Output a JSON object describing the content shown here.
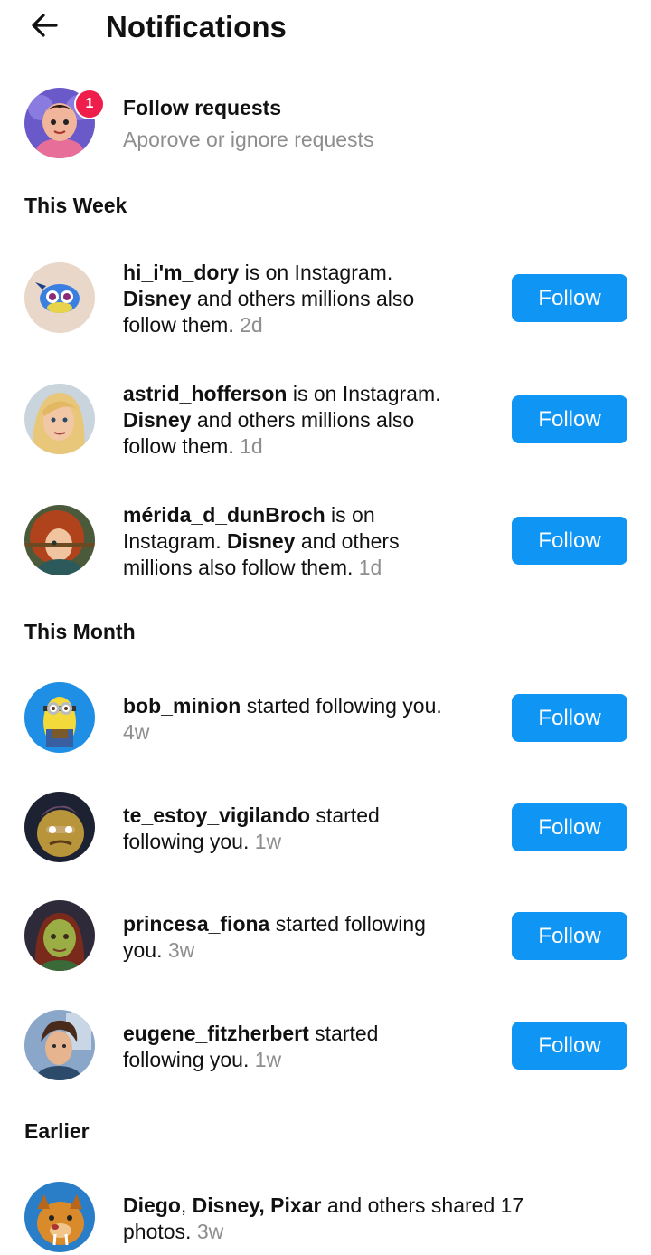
{
  "header": {
    "title": "Notifications",
    "back_icon": "arrow-left-icon"
  },
  "follow_requests": {
    "title": "Follow requests",
    "subtitle": "Aporove or ignore requests",
    "badge_count": "1"
  },
  "sections": {
    "this_week": "This Week",
    "this_month": "This Month",
    "earlier": "Earlier"
  },
  "labels": {
    "is_on_instagram": "is on Instagram.",
    "is_on": "is on",
    "instagram": "Instagram.",
    "disney": "Disney",
    "and_others_millions_also": "and others millions also",
    "follow_them": "follow them.",
    "and_others": "and others",
    "millions_also_follow_them": "millions also follow them.",
    "started_following_you": "started following you.",
    "started": "started",
    "following_you": "following you.",
    "started_following": "started following",
    "you": "you.",
    "follow_button": "Follow"
  },
  "notifications": [
    {
      "username": "hi_i'm_dory",
      "time": "2d"
    },
    {
      "username": "astrid_hofferson",
      "time": "1d"
    },
    {
      "username": "mérida_d_dunBroch",
      "time": "1d"
    },
    {
      "username": "bob_minion",
      "time": "4w"
    },
    {
      "username": "te_estoy_vigilando",
      "time": "1w"
    },
    {
      "username": "princesa_fiona",
      "time": "3w"
    },
    {
      "username": "eugene_fitzherbert",
      "time": "1w"
    }
  ],
  "earlier_item": {
    "name1": "Diego",
    "comma": ",",
    "names": "Disney, Pixar",
    "rest": "and others shared 17",
    "photos": "photos.",
    "time": "3w"
  },
  "colors": {
    "follow_button_bg": "#0f95f3",
    "badge_bg": "#ee1d4b",
    "secondary_text": "#8e8e8e"
  }
}
